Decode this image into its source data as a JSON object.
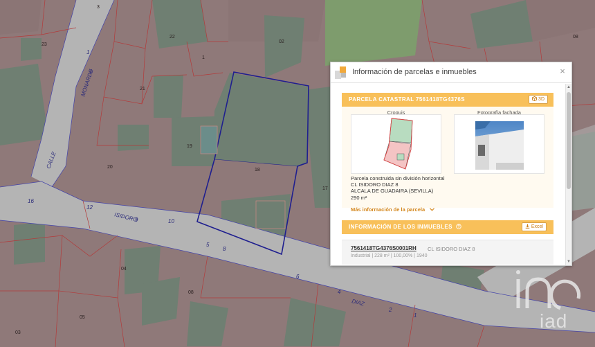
{
  "map": {
    "parcel_numbers": [
      "3",
      "23",
      "1",
      "22",
      "02",
      "08",
      "21",
      "19",
      "20",
      "18",
      "17",
      "04",
      "08",
      "05",
      "03"
    ],
    "street_names": [
      "CALLE",
      "MONARDE",
      "ISIDORO",
      "DIAZ"
    ],
    "street_numbers": [
      "3",
      "2",
      "1",
      "16",
      "12",
      "9",
      "10",
      "5",
      "8",
      "6",
      "4",
      "2",
      "1"
    ]
  },
  "panel": {
    "title": "Información de parcelas e inmuebles",
    "close_symbol": "×",
    "parcel": {
      "heading": "PARCELA CATASTRAL 7561418TG4376S",
      "btn_3d": "3D",
      "croquis_label": "Croquis",
      "photo_label": "Fotografía fachada",
      "description": "Parcela construida sin división horizontal",
      "address": "CL ISIDORO DIAZ 8",
      "city": "ALCALA DE GUADAIRA (SEVILLA)",
      "area": "290 m²",
      "more_info": "Más información de la parcela"
    },
    "inmuebles": {
      "heading": "INFORMACIÓN DE LOS INMUEBLES",
      "btn_excel": "Excel",
      "items": [
        {
          "ref": "7561418TG4376S0001RH",
          "address": "CL ISIDORO DIAZ 8",
          "details": "Industrial | 228 m² | 100,00% | 1940"
        }
      ]
    }
  },
  "brand": {
    "logo_text": "iad"
  },
  "colors": {
    "map_parcel": "#8e7878",
    "map_block": "#6f7f72",
    "map_street": "#b4b4b4",
    "accent_orange": "#f8c05a",
    "selection_blue": "#1f1f8f"
  }
}
